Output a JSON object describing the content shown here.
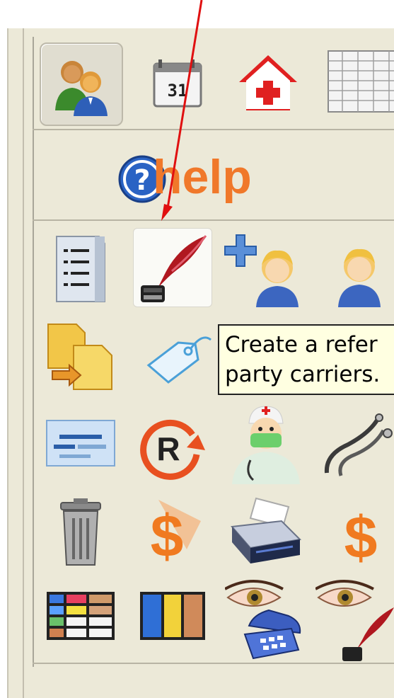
{
  "toolbar": {
    "items": [
      {
        "icon": "patients-icon"
      },
      {
        "icon": "calendar-icon",
        "text": "31"
      },
      {
        "icon": "hospital-icon"
      },
      {
        "icon": "spreadsheet-icon"
      }
    ]
  },
  "help": {
    "label": "help",
    "icon": "help-question-icon"
  },
  "grid": {
    "rows": [
      [
        "list-document-icon",
        "quill-pen-icon",
        "add-user-icon",
        "user-icon"
      ],
      [
        "copy-documents-icon",
        "tag-icon",
        "",
        ""
      ],
      [
        "message-card-icon",
        "registered-refresh-icon",
        "doctor-icon",
        "stethoscope-icon"
      ],
      [
        "trash-icon",
        "fast-dollar-icon",
        "printer-icon",
        "dollar-icon"
      ],
      [
        "color-grid-icon",
        "color-columns-icon",
        "eye-phone-icon",
        "eye-quill-icon"
      ]
    ]
  },
  "tooltip": {
    "line1": "Create a refer",
    "line2": "party carriers."
  },
  "colors": {
    "help_orange": "#f0782a",
    "arrow_red": "#e01010",
    "tooltip_bg": "#ffffe1"
  }
}
